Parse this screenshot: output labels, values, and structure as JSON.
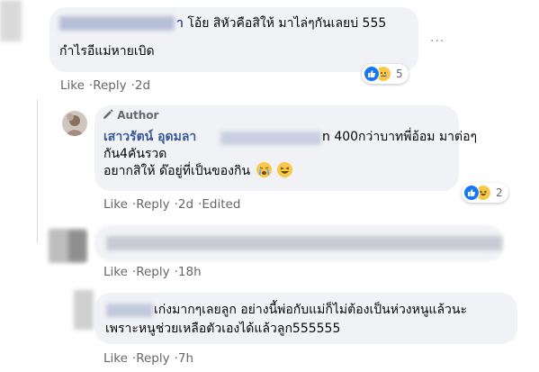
{
  "comment1": {
    "name_suffix": "า",
    "line1": "โอ้ย สิหัวคือสิให้ มาไล่ๆกันเลยบ่ 555",
    "line2": "กำไรอีแม่หายเบิด",
    "reaction_count": "5",
    "like": "Like",
    "reply": "Reply",
    "time": "2d"
  },
  "reply1": {
    "author_badge": "Author",
    "name": "เสาวรัตน์ อุดมลา",
    "line1_rest": "n 400กว่าบาทพี่อ้อม มาต่อๆ",
    "line2": "กัน4คันรวด",
    "line3": "อยากสิให้ ด๊อยู่ที่เป็นของกิน",
    "reaction_count": "2",
    "like": "Like",
    "reply": "Reply",
    "time": "2d",
    "edited": "Edited"
  },
  "reply2": {
    "like": "Like",
    "reply": "Reply",
    "time": "18h"
  },
  "reply3": {
    "line1": "เก่งมากๆเลยลูก อย่างนี้พ่อกับแม่ก็ไม่ต้องเป็นห่วงหนูแล้วนะ",
    "line2": "เพราะหนูช่วยเหลือตัวเองได้แล้วลูก555555",
    "like": "Like",
    "reply": "Reply",
    "time": "7h"
  },
  "icons": {
    "more": "more-options-icon",
    "pencil": "pencil-icon",
    "like": "like-reaction-icon",
    "sad": "sad-reaction-icon",
    "haha": "haha-reaction-icon"
  }
}
